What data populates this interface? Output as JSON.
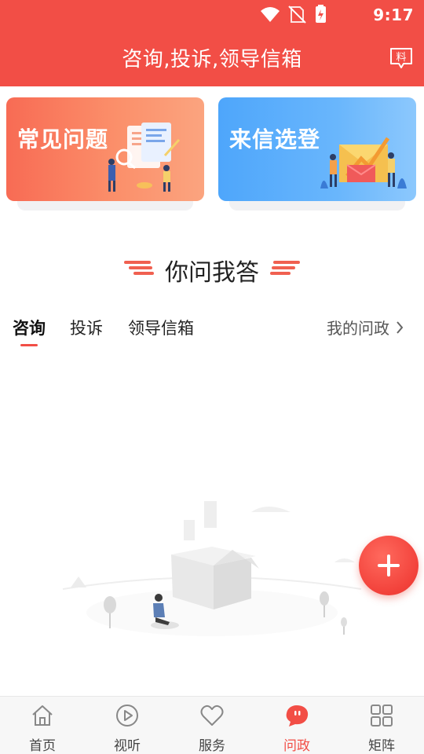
{
  "status_bar": {
    "time": "9:17"
  },
  "header": {
    "title": "咨询,投诉,领导信箱",
    "action_glyph": "料"
  },
  "cards": [
    {
      "label": "常见问题",
      "color": "#f86b54"
    },
    {
      "label": "来信选登",
      "color": "#4ea6fb"
    }
  ],
  "section": {
    "title": "你问我答"
  },
  "tabs": [
    {
      "label": "咨询",
      "active": true
    },
    {
      "label": "投诉",
      "active": false
    },
    {
      "label": "领导信箱",
      "active": false
    }
  ],
  "my_link": {
    "label": "我的问政"
  },
  "fab": {
    "icon": "plus-icon"
  },
  "bottom_nav": [
    {
      "label": "首页",
      "icon": "home-icon",
      "active": false
    },
    {
      "label": "视听",
      "icon": "play-icon",
      "active": false
    },
    {
      "label": "服务",
      "icon": "heart-icon",
      "active": false
    },
    {
      "label": "问政",
      "icon": "chat-bubble-icon",
      "active": true
    },
    {
      "label": "矩阵",
      "icon": "grid-icon",
      "active": false
    }
  ],
  "colors": {
    "accent": "#f24e46",
    "header_bg": "#f24e46"
  }
}
